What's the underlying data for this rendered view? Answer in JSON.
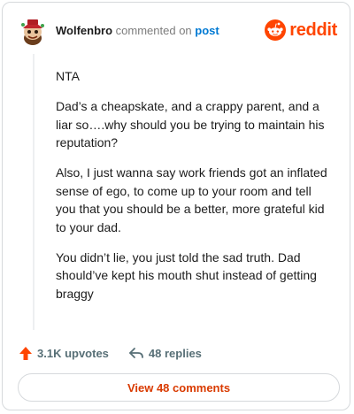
{
  "comment": {
    "username": "Wolfenbro",
    "action_text": "commented on",
    "post_link": "post",
    "paragraphs": [
      "NTA",
      "Dad’s a cheapskate, and a crappy parent, and a liar so….why should you be trying to maintain his reputation?",
      "Also, I just wanna say work friends got an inflated sense of ego, to come up to your room and tell you that you should be a better, more grateful kid to your dad.",
      "You didn’t lie, you just told the sad truth. Dad should’ve kept his mouth shut instead of getting braggy"
    ]
  },
  "brand": {
    "logo_text": "reddit",
    "color": "#ff4500"
  },
  "actions": {
    "upvotes": "3.1K upvotes",
    "replies": "48 replies",
    "upvote_color": "#ff4500",
    "icons": {
      "upvote": "upvote-arrow-icon",
      "reply": "reply-arrow-icon"
    }
  },
  "footer": {
    "view_comments_label": "View 48 comments",
    "label_color": "#d93a00"
  }
}
